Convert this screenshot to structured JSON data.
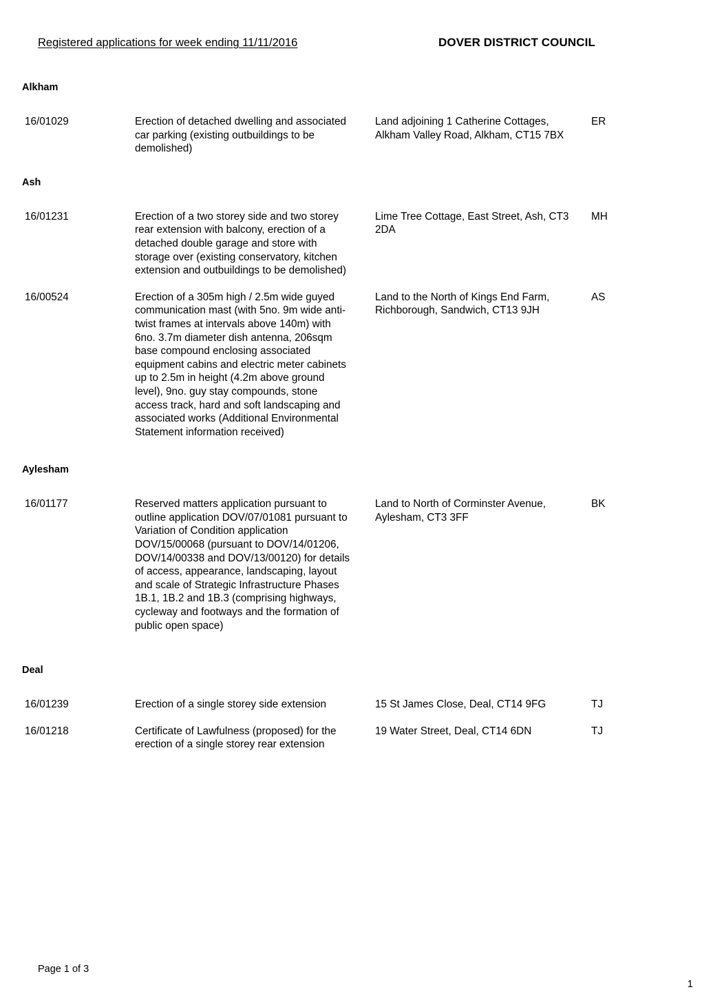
{
  "header": {
    "left_title": "Registered applications for week ending 11/11/2016",
    "right_title": "DOVER DISTRICT COUNCIL"
  },
  "sections": [
    {
      "parish": "Alkham",
      "applications": [
        {
          "reference": "16/01029",
          "description": "Erection of detached dwelling and associated car parking (existing outbuildings to be demolished)",
          "address": "Land adjoining 1 Catherine Cottages, Alkham Valley Road, Alkham, CT15 7BX",
          "officer": "ER"
        }
      ]
    },
    {
      "parish": "Ash",
      "applications": [
        {
          "reference": "16/01231",
          "description": "Erection of a two storey side and two storey rear extension with balcony, erection of a detached double garage and store with storage over (existing conservatory, kitchen extension and outbuildings to be demolished)",
          "address": "Lime Tree Cottage, East Street, Ash, CT3 2DA",
          "officer": "MH"
        },
        {
          "reference": "16/00524",
          "description": "Erection of a 305m high / 2.5m wide guyed communication mast (with 5no. 9m wide anti-twist frames at intervals above 140m) with 6no. 3.7m diameter dish antenna, 206sqm base compound enclosing associated equipment cabins and electric meter cabinets up to 2.5m in height (4.2m above ground level), 9no. guy stay compounds, stone access track, hard and soft landscaping and associated works (Additional Environmental Statement information received)",
          "address": "Land to the North of Kings End Farm, Richborough, Sandwich, CT13 9JH",
          "officer": "AS"
        }
      ]
    },
    {
      "parish": "Aylesham",
      "applications": [
        {
          "reference": "16/01177",
          "description": "Reserved matters application pursuant to outline application DOV/07/01081 pursuant to Variation of Condition application DOV/15/00068 (pursuant to DOV/14/01206, DOV/14/00338 and DOV/13/00120) for details of access, appearance, landscaping, layout and scale of Strategic Infrastructure Phases 1B.1, 1B.2 and 1B.3 (comprising highways, cycleway and footways and the formation of public open space)",
          "address": "Land to North of Corminster Avenue, Aylesham, CT3 3FF",
          "officer": "BK"
        }
      ]
    },
    {
      "parish": "Deal",
      "applications": [
        {
          "reference": "16/01239",
          "description": "Erection of a single storey side extension",
          "address": "15 St James Close, Deal, CT14 9FG",
          "officer": "TJ"
        },
        {
          "reference": "16/01218",
          "description": "Certificate of Lawfulness (proposed) for the erection of a single storey rear extension",
          "address": "19 Water Street, Deal, CT14 6DN",
          "officer": "TJ"
        }
      ]
    }
  ],
  "footer": {
    "page_label": "Page 1 of 3",
    "page_number": "1"
  }
}
